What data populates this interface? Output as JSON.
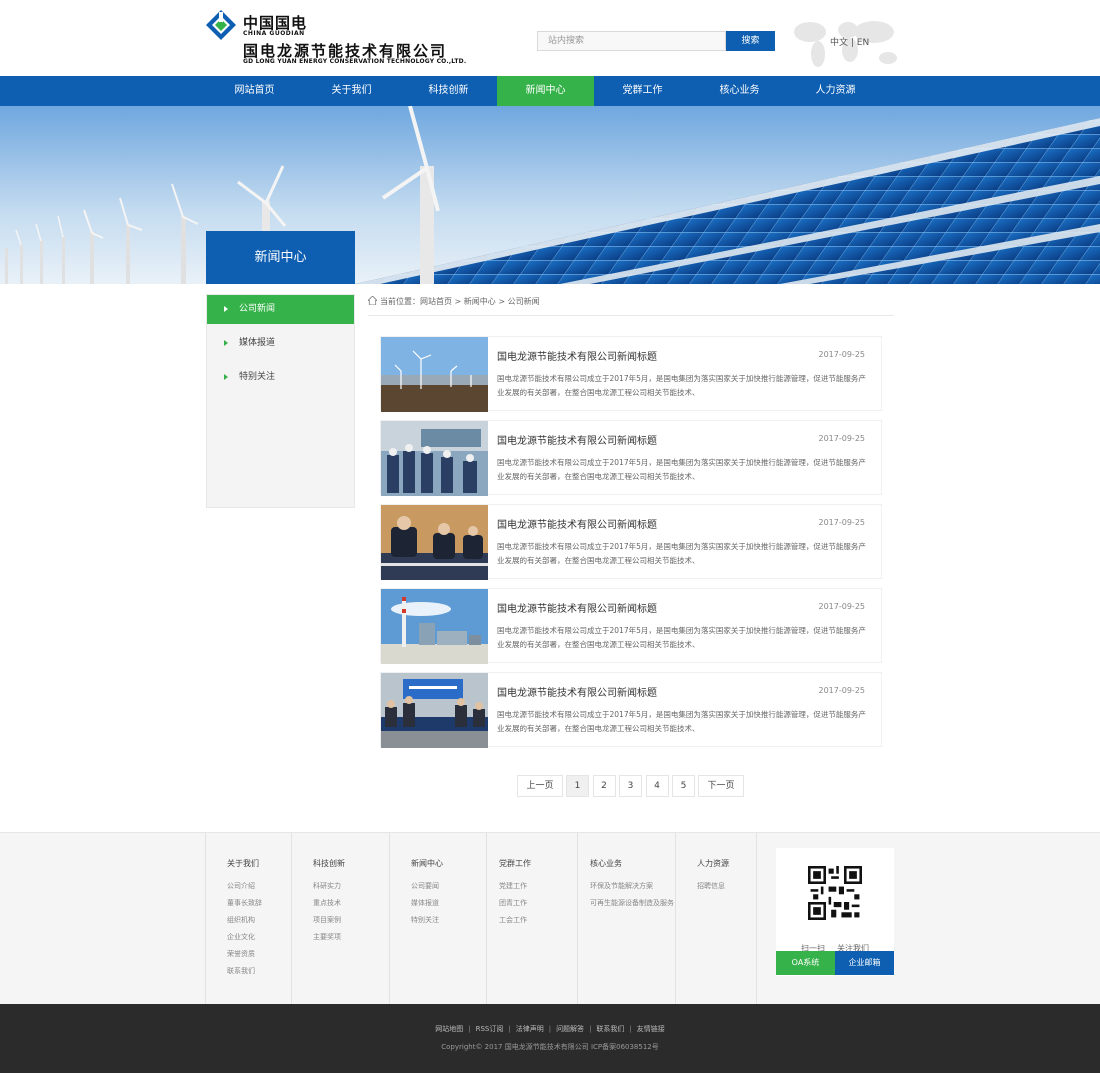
{
  "header": {
    "logo_cn": "中国国电",
    "logo_en": "CHINA GUODIAN",
    "company_cn": "国电龙源节能技术有限公司",
    "company_en": "GD LONG YUAN ENERGY CONSERVATION TECHNOLOGY CO.,LTD.",
    "search_placeholder": "站内搜索",
    "search_button": "搜索",
    "lang": "中文 | EN"
  },
  "nav": {
    "items": [
      "网站首页",
      "关于我们",
      "科技创新",
      "新闻中心",
      "党群工作",
      "核心业务",
      "人力资源"
    ],
    "active_index": 3
  },
  "banner": {
    "title": "新闻中心"
  },
  "sidebar": {
    "items": [
      "公司新闻",
      "媒体报道",
      "特别关注"
    ],
    "active_index": 0
  },
  "breadcrumb": "当前位置：网站首页 > 新闻中心 > 公司新闻",
  "news": [
    {
      "title": "国电龙源节能技术有限公司新闻标题",
      "date": "2017-09-25",
      "desc": "国电龙源节能技术有限公司成立于2017年5月，是国电集团为落实国家关于加快推行能源管理，促进节能服务产业发展的有关部署，在整合国电龙源工程公司相关节能技术、"
    },
    {
      "title": "国电龙源节能技术有限公司新闻标题",
      "date": "2017-09-25",
      "desc": "国电龙源节能技术有限公司成立于2017年5月，是国电集团为落实国家关于加快推行能源管理，促进节能服务产业发展的有关部署，在整合国电龙源工程公司相关节能技术、"
    },
    {
      "title": "国电龙源节能技术有限公司新闻标题",
      "date": "2017-09-25",
      "desc": "国电龙源节能技术有限公司成立于2017年5月，是国电集团为落实国家关于加快推行能源管理，促进节能服务产业发展的有关部署，在整合国电龙源工程公司相关节能技术、"
    },
    {
      "title": "国电龙源节能技术有限公司新闻标题",
      "date": "2017-09-25",
      "desc": "国电龙源节能技术有限公司成立于2017年5月，是国电集团为落实国家关于加快推行能源管理，促进节能服务产业发展的有关部署，在整合国电龙源工程公司相关节能技术、"
    },
    {
      "title": "国电龙源节能技术有限公司新闻标题",
      "date": "2017-09-25",
      "desc": "国电龙源节能技术有限公司成立于2017年5月，是国电集团为落实国家关于加快推行能源管理，促进节能服务产业发展的有关部署，在整合国电龙源工程公司相关节能技术、"
    }
  ],
  "pager": {
    "prev": "上一页",
    "pages": [
      "1",
      "2",
      "3",
      "4",
      "5"
    ],
    "current": "1",
    "next": "下一页"
  },
  "footer": {
    "columns": [
      {
        "title": "关于我们",
        "links": [
          "公司介绍",
          "董事长致辞",
          "组织机构",
          "企业文化",
          "荣誉资质",
          "联系我们"
        ]
      },
      {
        "title": "科技创新",
        "links": [
          "科研实力",
          "重点技术",
          "项目案例",
          "主要奖项"
        ]
      },
      {
        "title": "新闻中心",
        "links": [
          "公司要闻",
          "媒体报道",
          "特别关注"
        ]
      },
      {
        "title": "党群工作",
        "links": [
          "党建工作",
          "团青工作",
          "工会工作"
        ]
      },
      {
        "title": "核心业务",
        "links": [
          "环保及节能解决方案",
          "可再生能源设备制造及服务"
        ]
      },
      {
        "title": "人力资源",
        "links": [
          "招聘信息"
        ]
      }
    ],
    "qr_left": "扫一扫",
    "qr_right": "关注我们",
    "oa_button": "OA系统",
    "mail_button": "企业邮箱"
  },
  "bottom": {
    "links": [
      "网站地图",
      "RSS订阅",
      "法律声明",
      "问题解答",
      "联系我们",
      "友情链接"
    ],
    "copyright": "Copyright© 2017 国电龙源节能技术有限公司 ICP备案06038512号"
  },
  "colors": {
    "primary_blue": "#0e5fb2",
    "accent_green": "#36b24a"
  }
}
